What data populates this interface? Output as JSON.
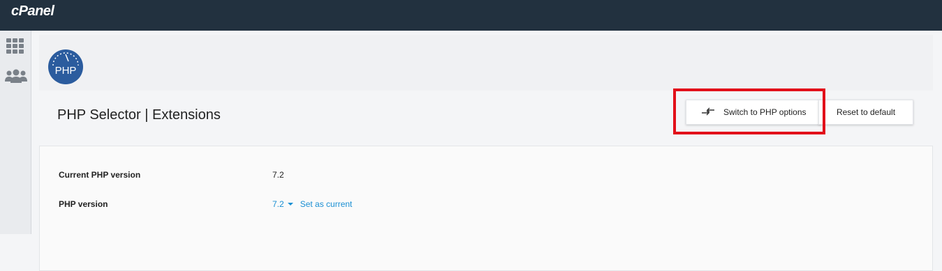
{
  "app": {
    "logo_text": "cPanel"
  },
  "sidebar": {
    "items": [
      {
        "icon": "grid-icon"
      },
      {
        "icon": "users-icon"
      }
    ]
  },
  "page": {
    "badge_text": "PHP",
    "title": "PHP Selector | Extensions"
  },
  "toolbar": {
    "switch_label": "Switch to PHP options",
    "reset_label": "Reset to default",
    "highlight_color": "#e2101a"
  },
  "details": {
    "current_version_label": "Current PHP version",
    "current_version_value": "7.2",
    "php_version_label": "PHP version",
    "php_version_selected": "7.2",
    "set_current_label": "Set as current"
  },
  "colors": {
    "topbar": "#22313f",
    "link": "#1a8fd3",
    "badge": "#2b5c9e"
  }
}
